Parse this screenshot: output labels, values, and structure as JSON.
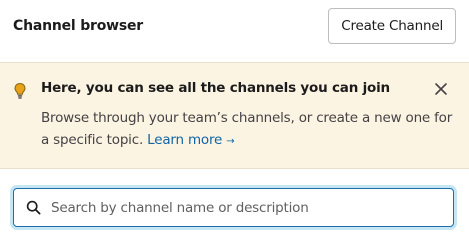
{
  "header": {
    "title": "Channel browser",
    "create_button_label": "Create Channel"
  },
  "banner": {
    "icon": "lightbulb-icon",
    "heading": "Here, you can see all the channels you can join",
    "body_text": "Browse through your team’s channels, or create a new one for a specific topic.",
    "learn_more_label": "Learn more",
    "learn_more_arrow": "→",
    "close_icon": "close-icon"
  },
  "search": {
    "placeholder": "Search by channel name or description",
    "value": "",
    "icon": "search-icon"
  },
  "colors": {
    "banner_background": "#fcf4e2",
    "link": "#1264a3",
    "focus_border": "#1d6ea8",
    "bulb": "#e8a317"
  }
}
